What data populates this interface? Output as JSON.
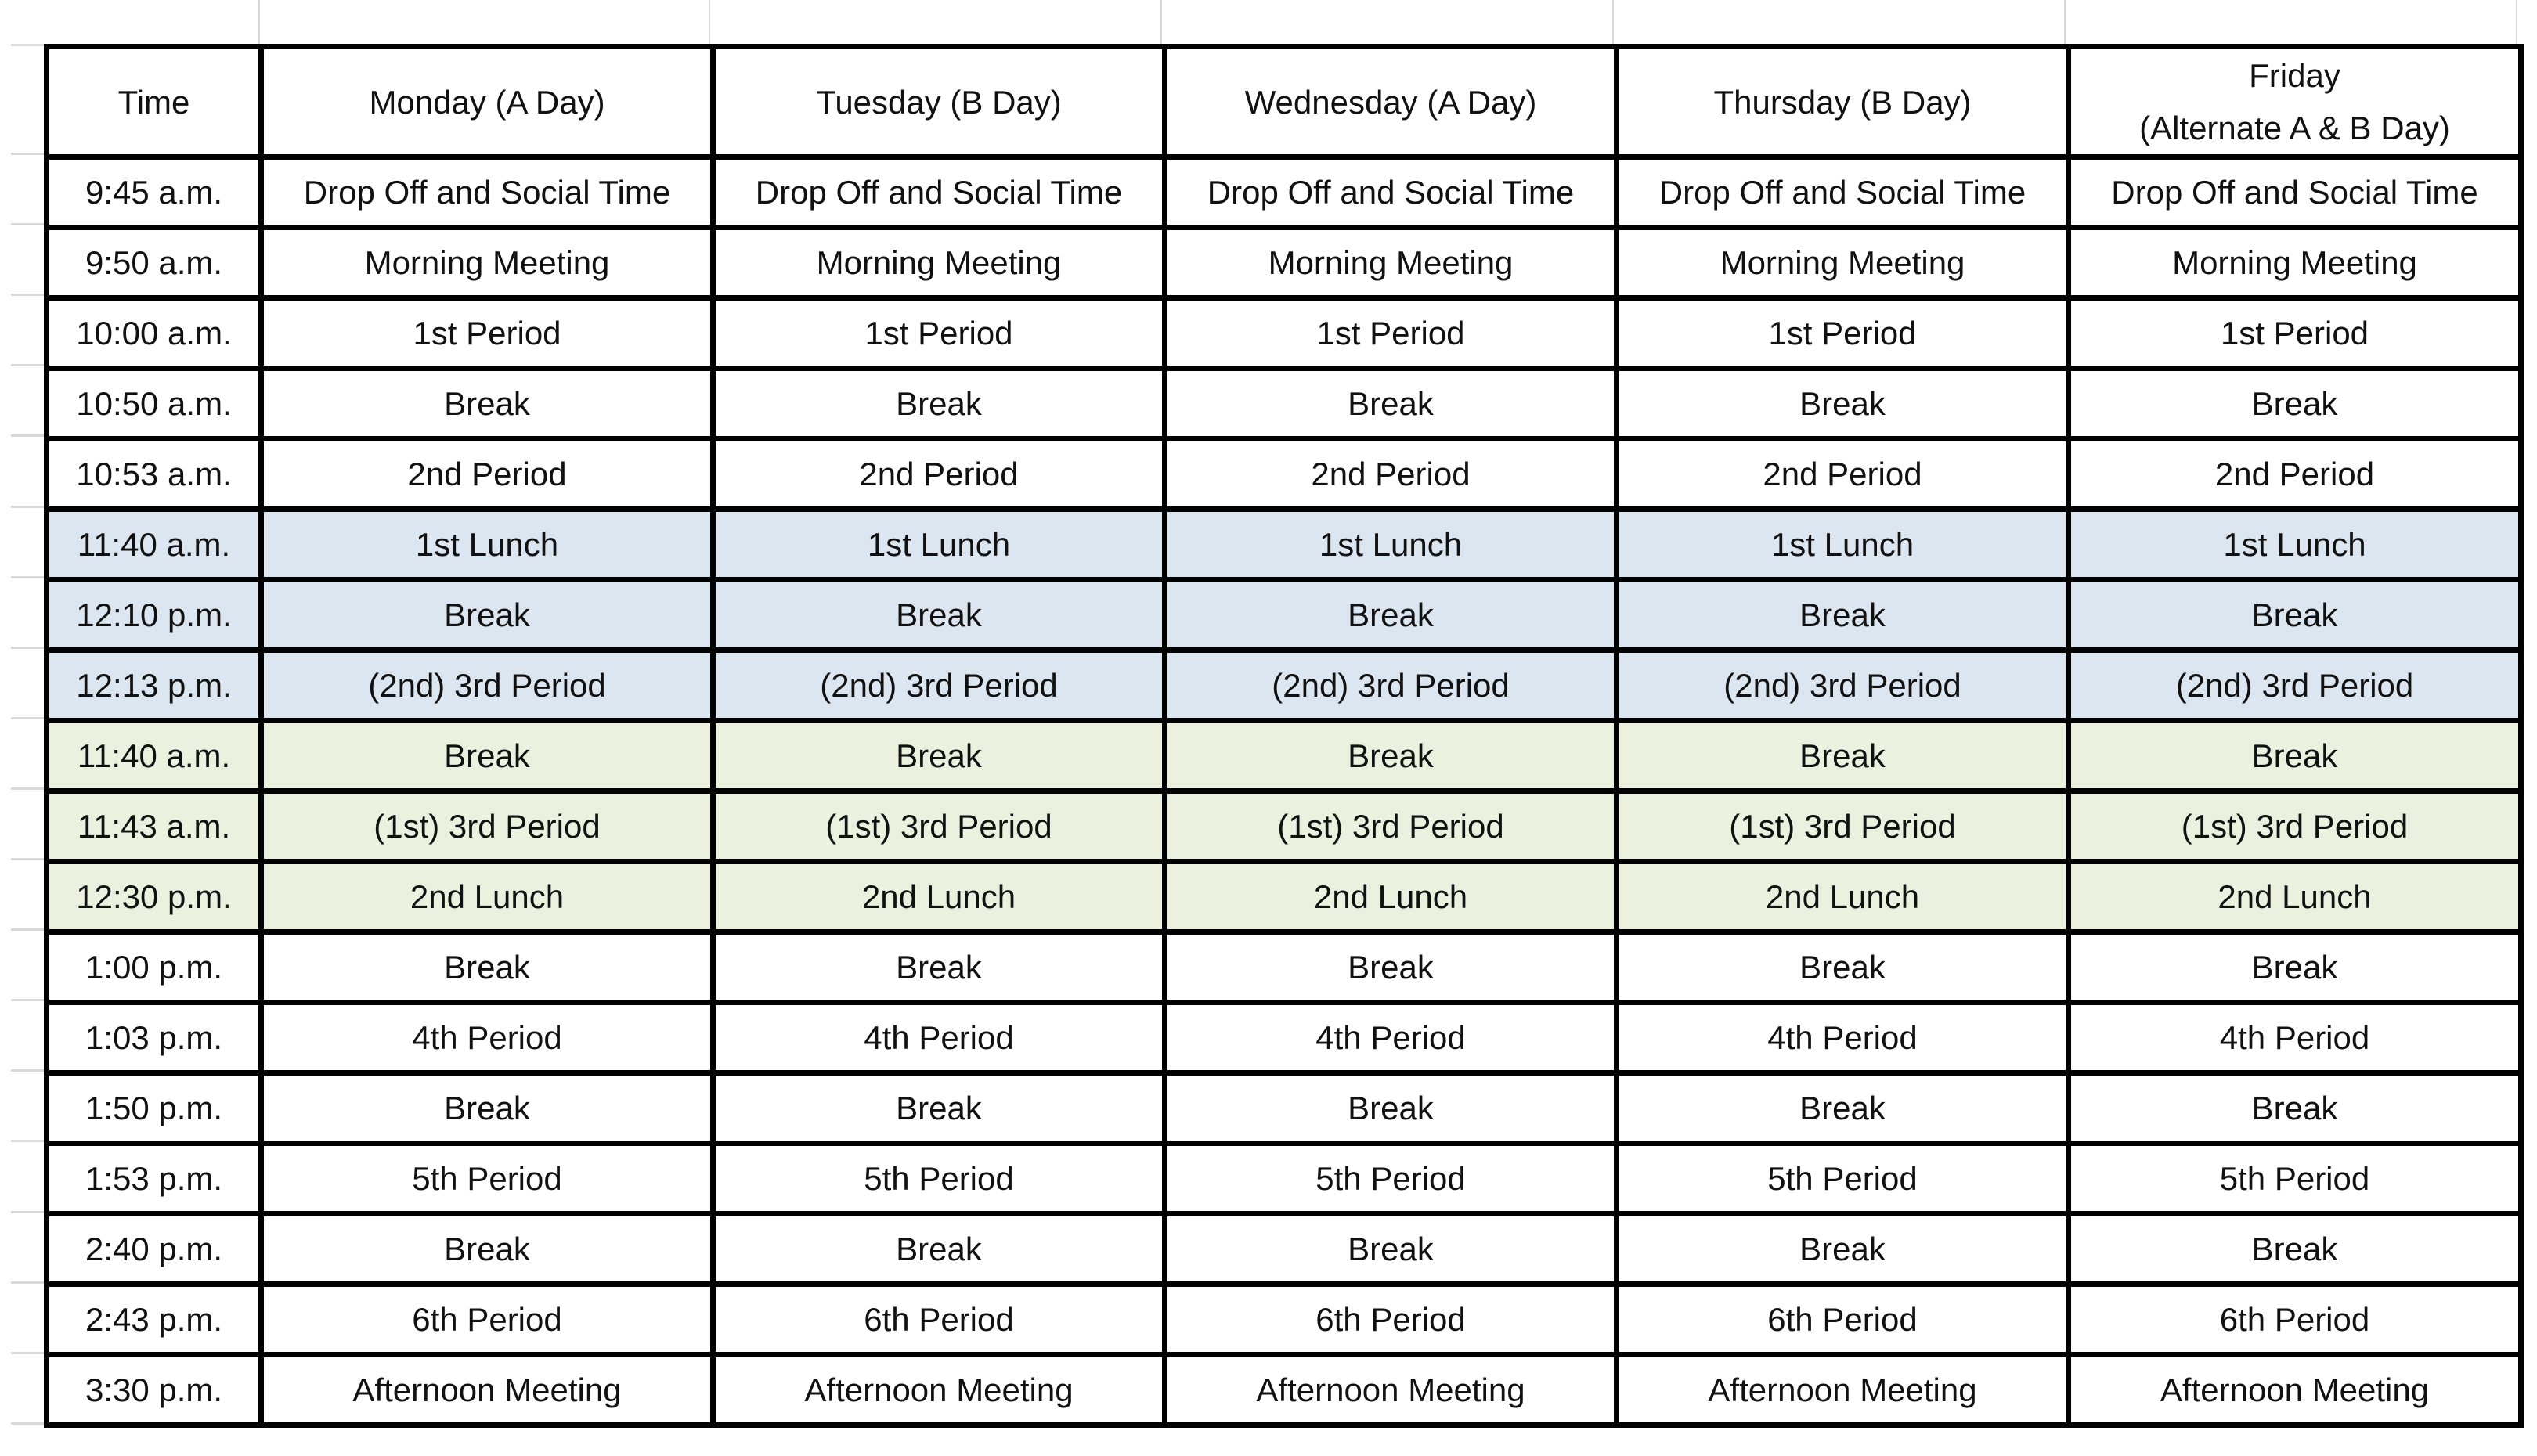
{
  "headers": [
    "Time",
    "Monday (A Day)",
    "Tuesday (B Day)",
    "Wednesday (A Day)",
    "Thursday (B Day)",
    "Friday\n(Alternate A & B Day)"
  ],
  "colors": {
    "first_lunch_group": "#dce6f1",
    "second_lunch_group": "#ebf1de",
    "border": "#000000"
  },
  "rows": [
    {
      "time": "9:45 a.m.",
      "activity": "Drop Off and Social Time",
      "group": ""
    },
    {
      "time": "9:50 a.m.",
      "activity": "Morning Meeting",
      "group": ""
    },
    {
      "time": "10:00 a.m.",
      "activity": "1st Period",
      "group": ""
    },
    {
      "time": "10:50 a.m.",
      "activity": "Break",
      "group": ""
    },
    {
      "time": "10:53 a.m.",
      "activity": "2nd Period",
      "group": ""
    },
    {
      "time": "11:40 a.m.",
      "activity": "1st Lunch",
      "group": "lunch1"
    },
    {
      "time": "12:10 p.m.",
      "activity": "Break",
      "group": "lunch1"
    },
    {
      "time": "12:13 p.m.",
      "activity": "(2nd) 3rd Period",
      "group": "lunch1"
    },
    {
      "time": "11:40 a.m.",
      "activity": "Break",
      "group": "lunch2"
    },
    {
      "time": "11:43 a.m.",
      "activity": "(1st) 3rd Period",
      "group": "lunch2"
    },
    {
      "time": "12:30 p.m.",
      "activity": "2nd Lunch",
      "group": "lunch2"
    },
    {
      "time": "1:00 p.m.",
      "activity": "Break",
      "group": ""
    },
    {
      "time": "1:03 p.m.",
      "activity": "4th Period",
      "group": ""
    },
    {
      "time": "1:50 p.m.",
      "activity": "Break",
      "group": ""
    },
    {
      "time": "1:53 p.m.",
      "activity": "5th Period",
      "group": ""
    },
    {
      "time": "2:40 p.m.",
      "activity": "Break",
      "group": ""
    },
    {
      "time": "2:43 p.m.",
      "activity": "6th Period",
      "group": ""
    },
    {
      "time": "3:30 p.m.",
      "activity": "Afternoon Meeting",
      "group": ""
    }
  ]
}
